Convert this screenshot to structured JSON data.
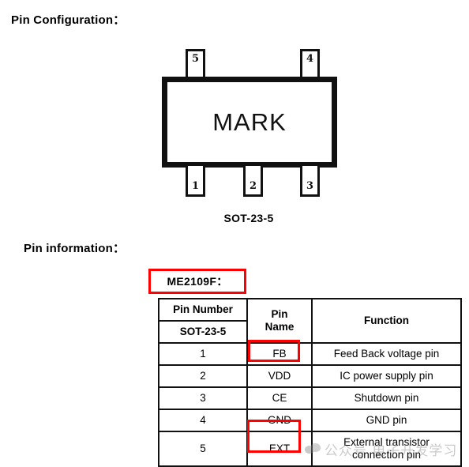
{
  "document": {
    "sections": {
      "pin_configuration_heading": "Pin Configuration：",
      "pin_information_heading": "Pin information："
    },
    "package_diagram": {
      "mark_text": "MARK",
      "package_label": "SOT-23-5",
      "top_pins": [
        {
          "number": "5"
        },
        {
          "number": "4"
        }
      ],
      "bottom_pins": [
        {
          "number": "1"
        },
        {
          "number": "2"
        },
        {
          "number": "3"
        }
      ]
    },
    "part_title": {
      "label": "ME2109F：",
      "highlight_color": "#ff0000"
    },
    "pin_table": {
      "headers": {
        "pin_number": "Pin Number",
        "package": "SOT-23-5",
        "pin_name": "Pin Name",
        "pin_name_line1": "Pin",
        "pin_name_line2": "Name",
        "function": "Function"
      },
      "rows": [
        {
          "pin_number": "1",
          "pin_name": "FB",
          "function": "Feed Back voltage pin",
          "highlighted": true
        },
        {
          "pin_number": "2",
          "pin_name": "VDD",
          "function": "IC power supply pin",
          "highlighted": false
        },
        {
          "pin_number": "3",
          "pin_name": "CE",
          "function": "Shutdown pin",
          "highlighted": false
        },
        {
          "pin_number": "4",
          "pin_name": "GND",
          "function": "GND pin",
          "highlighted": false
        },
        {
          "pin_number": "5",
          "pin_name": "EXT",
          "function": "External transistor connection pin",
          "function_line1": "External transistor",
          "function_line2": "connection pin",
          "highlighted": true
        }
      ]
    },
    "watermark": {
      "text": "公众号 电子开发学习",
      "logo_name": "wechat-logo-icon"
    }
  }
}
